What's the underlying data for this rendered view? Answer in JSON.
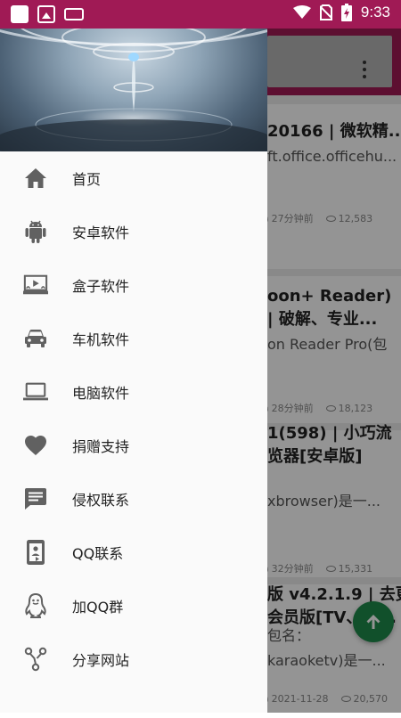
{
  "status_bar": {
    "time": "9:33",
    "icons": [
      "notification-square-icon",
      "image-icon",
      "keyboard-icon",
      "wifi-icon",
      "no-sim-icon",
      "battery-charging-icon"
    ]
  },
  "colors": {
    "accent": "#a01a55",
    "fab": "#1e8a4a",
    "icon": "#616161"
  },
  "drawer": {
    "items": [
      {
        "label": "首页",
        "icon": "home-icon"
      },
      {
        "label": "安卓软件",
        "icon": "android-icon"
      },
      {
        "label": "盒子软件",
        "icon": "tv-box-icon"
      },
      {
        "label": "车机软件",
        "icon": "car-icon"
      },
      {
        "label": "电脑软件",
        "icon": "laptop-icon"
      },
      {
        "label": "捐赠支持",
        "icon": "heart-icon"
      },
      {
        "label": "侵权联系",
        "icon": "message-icon"
      },
      {
        "label": "QQ联系",
        "icon": "phone-contact-icon"
      },
      {
        "label": "加QQ群",
        "icon": "penguin-icon"
      },
      {
        "label": "分享网站",
        "icon": "share-icon"
      }
    ]
  },
  "feed": {
    "cards": [
      {
        "title": "20166 | 微软精...",
        "desc": "ft.office.officehu...",
        "time": "27分钟前",
        "views": "12,583"
      },
      {
        "title_1": "oon+ Reader)",
        "title_2": "| 破解、专业...",
        "desc": "on Reader Pro(包",
        "time": "28分钟前",
        "views": "18,123"
      },
      {
        "title_1": "1(598) | 小巧流",
        "title_2": "览器[安卓版]",
        "desc": "xbrowser)是一...",
        "time": "32分钟前",
        "views": "15,331"
      },
      {
        "title_1": "版 v4.2.1.9 | 去更",
        "title_2": "会员版[TV、盒...",
        "desc": "包名：",
        "desc_2": "karaoketv)是一...",
        "time": "2021-11-28",
        "views": "20,570"
      }
    ]
  }
}
